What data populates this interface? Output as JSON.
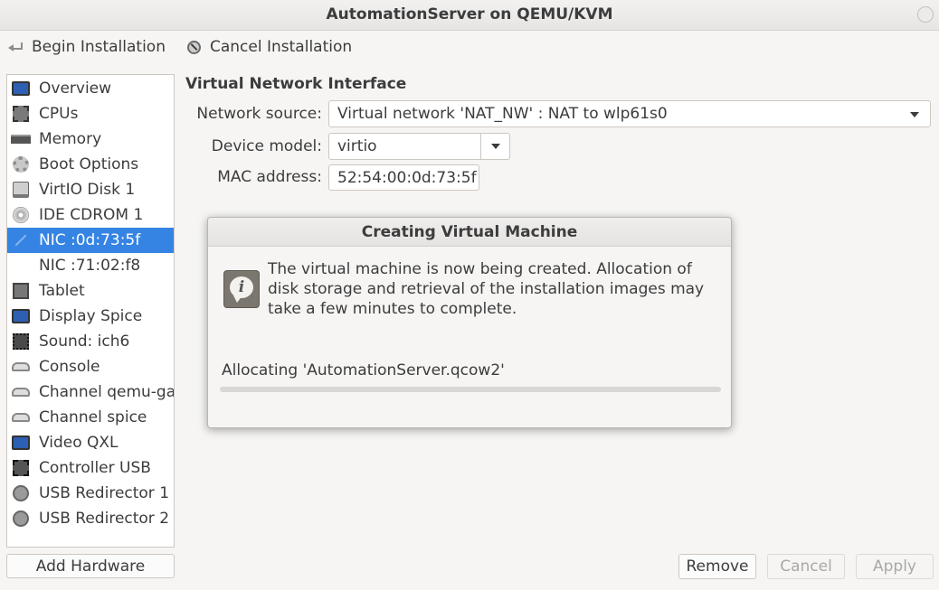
{
  "window": {
    "title": "AutomationServer on QEMU/KVM"
  },
  "toolbar": {
    "begin_label": "Begin Installation",
    "cancel_label": "Cancel Installation"
  },
  "sidebar": {
    "items": [
      {
        "label": "Overview",
        "icon": "monitor-icon"
      },
      {
        "label": "CPUs",
        "icon": "cpu-chip-icon"
      },
      {
        "label": "Memory",
        "icon": "memory-icon"
      },
      {
        "label": "Boot Options",
        "icon": "gear-icon"
      },
      {
        "label": "VirtIO Disk 1",
        "icon": "disk-icon"
      },
      {
        "label": "IDE CDROM 1",
        "icon": "cdrom-icon"
      },
      {
        "label": "NIC :0d:73:5f",
        "icon": "network-icon",
        "selected": true
      },
      {
        "label": "NIC :71:02:f8",
        "icon": ""
      },
      {
        "label": "Tablet",
        "icon": "tablet-icon"
      },
      {
        "label": "Display Spice",
        "icon": "display-icon"
      },
      {
        "label": "Sound: ich6",
        "icon": "sound-icon"
      },
      {
        "label": "Console",
        "icon": "console-icon"
      },
      {
        "label": "Channel qemu-ga",
        "icon": "channel-icon"
      },
      {
        "label": "Channel spice",
        "icon": "channel-icon"
      },
      {
        "label": "Video QXL",
        "icon": "video-icon"
      },
      {
        "label": "Controller USB",
        "icon": "usb-controller-icon"
      },
      {
        "label": "USB Redirector 1",
        "icon": "usb-redirector-icon"
      },
      {
        "label": "USB Redirector 2",
        "icon": "usb-redirector-icon"
      }
    ],
    "add_hardware_label": "Add Hardware"
  },
  "details": {
    "section_title": "Virtual Network Interface",
    "network_source_label": "Network source:",
    "network_source_value": "Virtual network 'NAT_NW' : NAT to wlp61s0",
    "device_model_label": "Device model:",
    "device_model_value": "virtio",
    "mac_label": "MAC address:",
    "mac_value": "52:54:00:0d:73:5f"
  },
  "dialog": {
    "title": "Creating Virtual Machine",
    "message": "The virtual machine is now being created. Allocation of disk storage and retrieval of the installation images may take a few minutes to complete.",
    "status": "Allocating 'AutomationServer.qcow2'",
    "progress": 0
  },
  "buttons": {
    "remove": "Remove",
    "cancel": "Cancel",
    "apply": "Apply"
  },
  "colors": {
    "selection": "#3584e4"
  }
}
